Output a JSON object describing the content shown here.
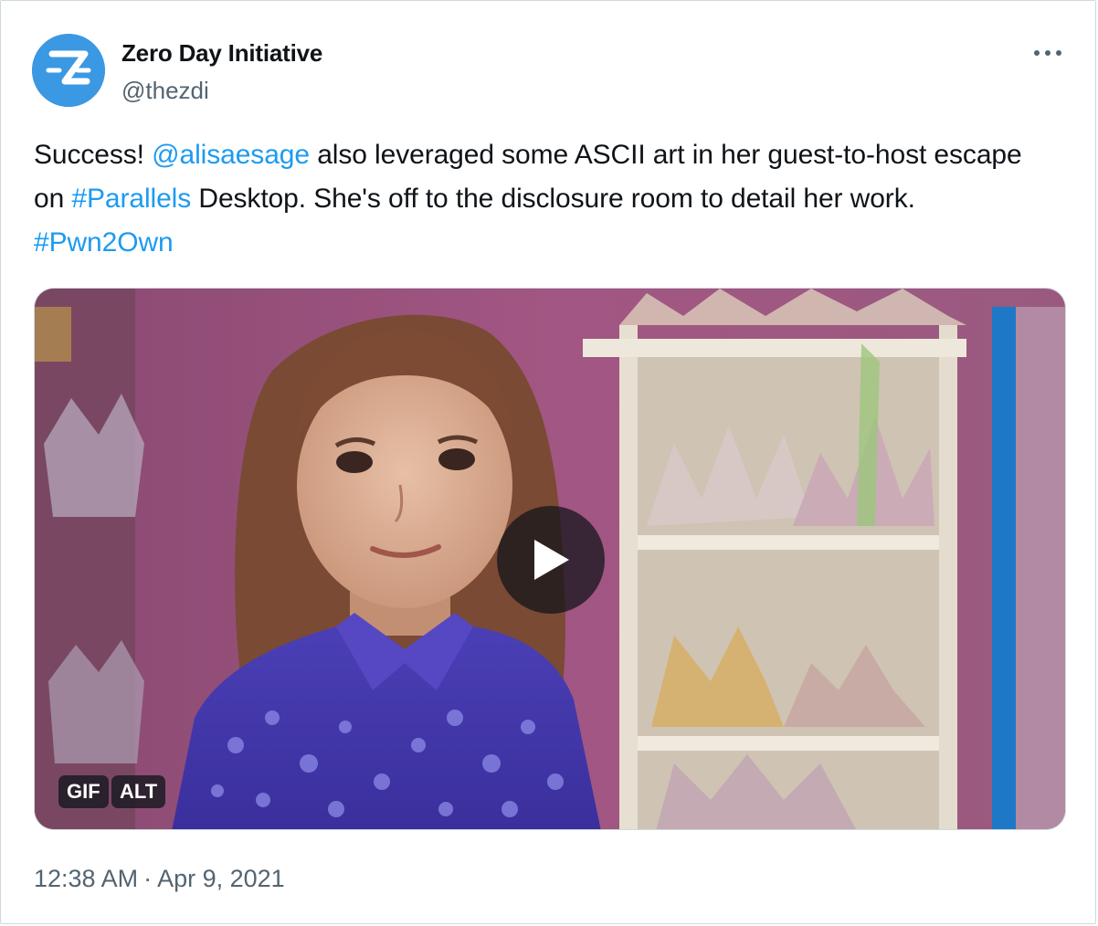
{
  "author": {
    "name": "Zero Day Initiative",
    "handle": "@thezdi",
    "avatar_icon": "zdi-logo",
    "avatar_color": "#3b98e2"
  },
  "tweet": {
    "text_parts": [
      {
        "text": "Success! ",
        "link": false
      },
      {
        "text": "@alisaesage",
        "link": true
      },
      {
        "text": " also leveraged some ASCII art in her guest-to-host escape on ",
        "link": false
      },
      {
        "text": "#Parallels",
        "link": true
      },
      {
        "text": " Desktop. She's off to the disclosure room to detail her work. ",
        "link": false
      },
      {
        "text": "#Pwn2Own",
        "link": true
      }
    ]
  },
  "media": {
    "gif_badge": "GIF",
    "alt_badge": "ALT",
    "play_icon": "play-icon"
  },
  "footer": {
    "time": "12:38 AM",
    "separator": "·",
    "date": "Apr 9, 2021"
  },
  "colors": {
    "link": "#1d9bf0",
    "secondary_text": "#536471",
    "primary_text": "#0f1419"
  },
  "more_icon": "more-horizontal-icon"
}
